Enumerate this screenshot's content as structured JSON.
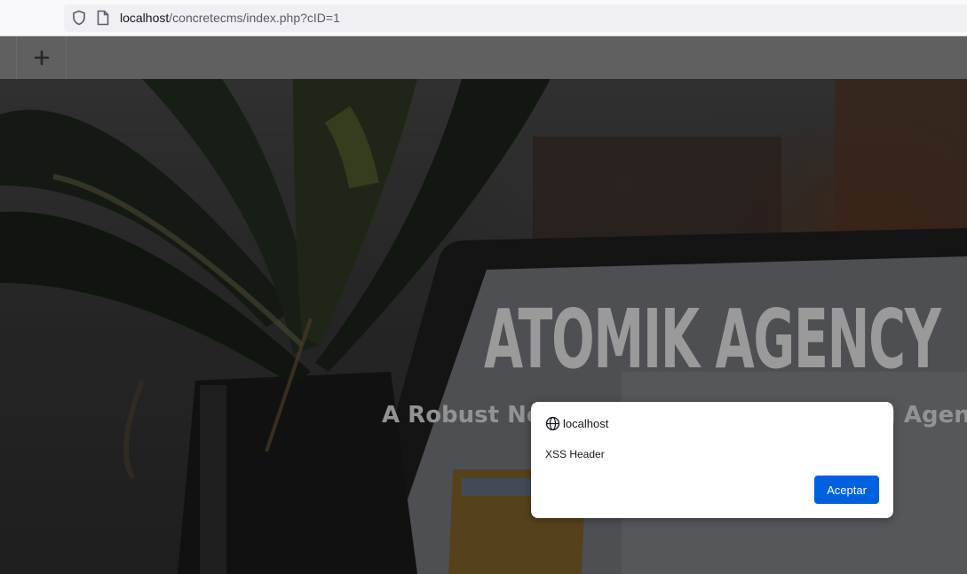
{
  "browser": {
    "url_host": "localhost",
    "url_path": "/concretecms/index.php?cID=1",
    "icons": [
      "shield-icon",
      "page-icon"
    ]
  },
  "toolbar": {
    "add_icon": "plus-icon",
    "add_glyph": "+"
  },
  "hero": {
    "title": "ATOMIK AGENCY",
    "subtitle": "A Robust New Theme for the Marketing Agency"
  },
  "dialog": {
    "origin": "localhost",
    "origin_icon": "globe-icon",
    "message": "XSS Header",
    "ok_label": "Aceptar"
  },
  "colors": {
    "accent": "#0061e0",
    "toolbar": "#6e6e6e"
  }
}
